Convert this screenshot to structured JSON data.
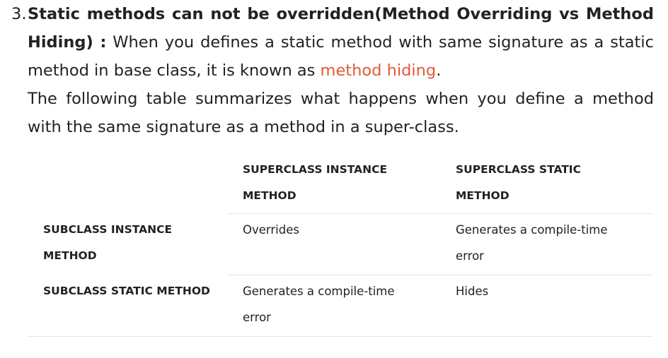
{
  "item": {
    "number": "3.",
    "heading": "Static methods can not be overridden(Method Overriding vs Method Hiding) :",
    "text_before_link": " When you defines a static method with same signature as a static method in base class, it is known as ",
    "link": "method hiding",
    "text_after_link": ".",
    "paragraph2": "The following table summarizes what happens when you define a method with the same signature as a method in a super-class."
  },
  "table": {
    "headers": [
      "",
      "SUPERCLASS INSTANCE METHOD",
      "SUPERCLASS STATIC METHOD"
    ],
    "rows": [
      {
        "label": "SUBCLASS INSTANCE METHOD",
        "cells": [
          "Overrides",
          "Generates a compile-time error"
        ]
      },
      {
        "label": "SUBCLASS STATIC METHOD",
        "cells": [
          "Generates a compile-time error",
          "Hides"
        ]
      }
    ]
  },
  "colors": {
    "text": "#222222",
    "link": "#e05a35",
    "rule": "#e6e6e6"
  }
}
